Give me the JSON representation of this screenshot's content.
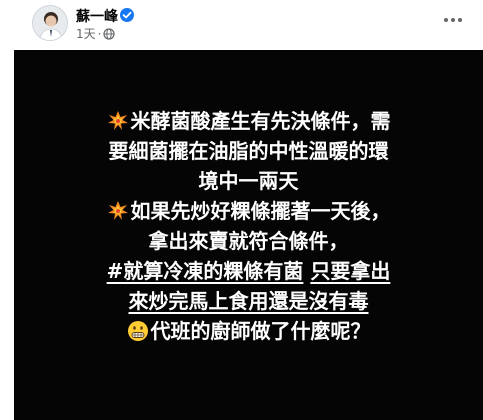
{
  "post": {
    "author": "蘇一峰",
    "time": "1天",
    "privacy_icon": "globe-icon",
    "verified_icon": "verified-badge-icon",
    "more_icon": "more-options-icon"
  },
  "image": {
    "lines": [
      {
        "emoji": "collision-icon",
        "parts": [
          {
            "text": "米酵菌酸產生有先決條件，需",
            "u": false
          }
        ]
      },
      {
        "emoji": null,
        "parts": [
          {
            "text": "要細菌擺在油脂的中性溫暖的環",
            "u": false
          }
        ]
      },
      {
        "emoji": null,
        "parts": [
          {
            "text": "境中一兩天",
            "u": false
          }
        ]
      },
      {
        "emoji": "collision-icon",
        "parts": [
          {
            "text": "如果先炒好粿條擺著一天後，",
            "u": false
          }
        ]
      },
      {
        "emoji": null,
        "parts": [
          {
            "text": "拿出來賣就符合條件，",
            "u": false
          }
        ]
      },
      {
        "emoji": null,
        "parts": [
          {
            "text": "#就算冷凍的粿條有菌",
            "u": true
          },
          {
            "text": " ",
            "u": false
          },
          {
            "text": "只要拿出",
            "u": true
          }
        ]
      },
      {
        "emoji": null,
        "parts": [
          {
            "text": "來炒完馬上食用還是沒有毒",
            "u": true
          }
        ]
      },
      {
        "emoji": "grimacing-face-icon",
        "parts": [
          {
            "text": "代班的廚師做了什麼呢？",
            "u": false
          }
        ]
      }
    ]
  }
}
